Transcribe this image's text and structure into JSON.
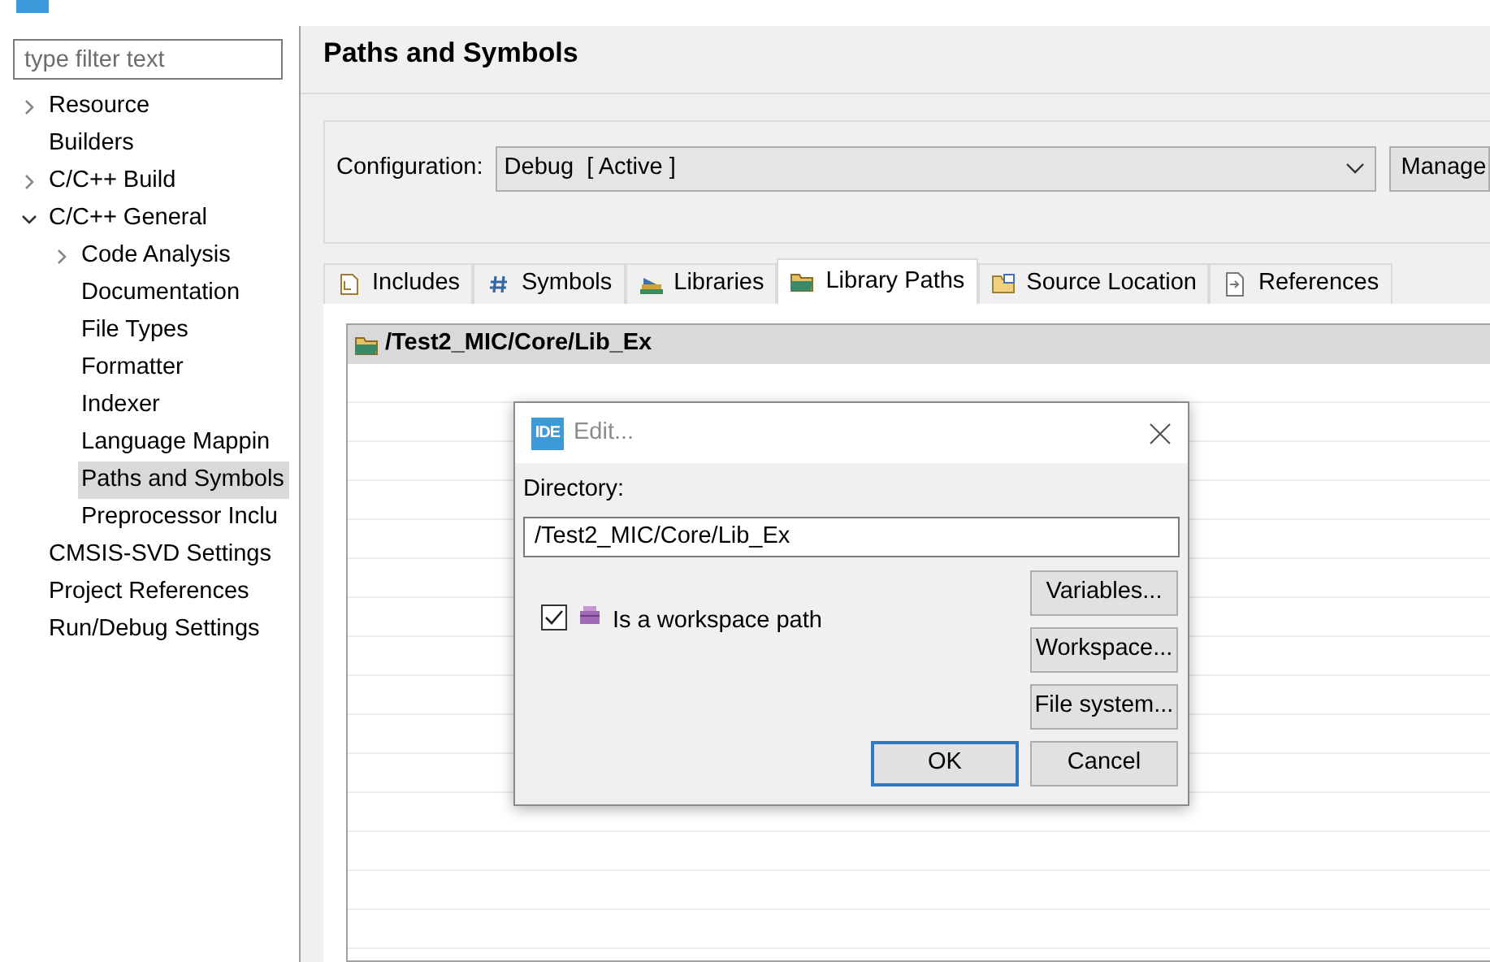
{
  "filter": {
    "placeholder": "type filter text"
  },
  "tree": [
    {
      "label": "Resource",
      "expanded": false,
      "selected": false
    },
    {
      "label": "Builders",
      "selected": false
    },
    {
      "label": "C/C++ Build",
      "expanded": false,
      "selected": false
    },
    {
      "label": "C/C++ General",
      "expanded": true,
      "selected": false,
      "children": [
        {
          "label": "Code Analysis",
          "expanded": false,
          "selected": false
        },
        {
          "label": "Documentation",
          "selected": false
        },
        {
          "label": "File Types",
          "selected": false
        },
        {
          "label": "Formatter",
          "selected": false
        },
        {
          "label": "Indexer",
          "selected": false
        },
        {
          "label": "Language Mappin",
          "selected": false
        },
        {
          "label": "Paths and Symbols",
          "selected": true
        },
        {
          "label": "Preprocessor Inclu",
          "selected": false
        }
      ]
    },
    {
      "label": "CMSIS-SVD Settings",
      "selected": false
    },
    {
      "label": "Project References",
      "selected": false
    },
    {
      "label": "Run/Debug Settings",
      "selected": false
    }
  ],
  "page_title": "Paths and Symbols",
  "configuration": {
    "label": "Configuration:",
    "value": "Debug  [ Active ]",
    "manage_button": "Manage"
  },
  "tabs": [
    {
      "label": "Includes",
      "kind": "includes",
      "selected": false
    },
    {
      "label": "Symbols",
      "kind": "symbols",
      "selected": false
    },
    {
      "label": "Libraries",
      "kind": "libraries",
      "selected": false
    },
    {
      "label": "Library Paths",
      "kind": "folder",
      "selected": true
    },
    {
      "label": "Source Location",
      "kind": "source",
      "selected": false
    },
    {
      "label": "References",
      "kind": "references",
      "selected": false
    }
  ],
  "paths": [
    {
      "path": "/Test2_MIC/Core/Lib_Ex",
      "selected": true
    }
  ],
  "dialog": {
    "logo": "IDE",
    "title": "Edit...",
    "directory_label": "Directory:",
    "directory_value": "/Test2_MIC/Core/Lib_Ex",
    "workspace_checkbox": {
      "label": "Is a workspace path",
      "checked": true
    },
    "side_buttons": [
      "Variables...",
      "Workspace...",
      "File system..."
    ],
    "buttons": [
      {
        "label": "OK",
        "default": true
      },
      {
        "label": "Cancel",
        "default": false
      }
    ]
  }
}
